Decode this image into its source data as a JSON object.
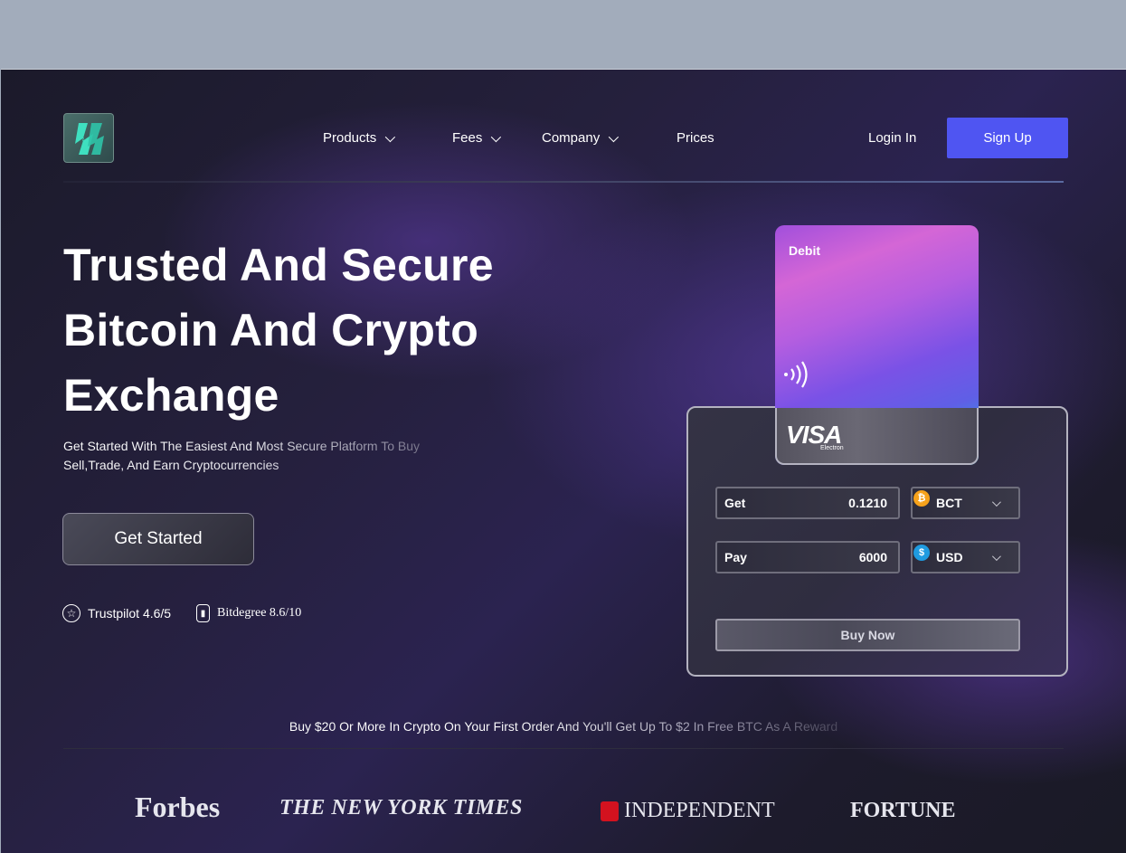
{
  "nav": {
    "logo_icon": "brand-logo-icon",
    "items": [
      {
        "label": "Products",
        "has_dropdown": true
      },
      {
        "label": "Fees",
        "has_dropdown": true
      },
      {
        "label": "Company",
        "has_dropdown": true
      },
      {
        "label": "Prices",
        "has_dropdown": false
      }
    ],
    "login": "Login In",
    "signup": "Sign Up"
  },
  "hero": {
    "title": "Trusted And Secure Bitcoin And Crypto Exchange",
    "subtitle": "Get Started  With The Easiest  And Most Secure Platform To Buy Sell,Trade, And Earn Cryptocurrencies",
    "cta": "Get Started",
    "ratings": [
      {
        "icon": "star-icon",
        "label": "Trustpilot 4.6/5"
      },
      {
        "icon": "badge-icon",
        "label": "Bitdegree 8.6/10"
      }
    ]
  },
  "card": {
    "type": "Debit",
    "contactless_icon": "contactless-icon",
    "brand": "VISA",
    "brand_sub": "Electron"
  },
  "exchange": {
    "get_label": "Get",
    "get_value": "0.1210",
    "get_currency": "BCT",
    "get_icon": "bitcoin-icon",
    "pay_label": "Pay",
    "pay_value": "6000",
    "pay_currency": "USD",
    "pay_icon": "dollar-icon",
    "buy_label": "Buy Now"
  },
  "promo": "Buy $20 Or More In Crypto On Your First  Order  And You'll Get Up To $2 In Free BTC As A Reward",
  "press": [
    "Forbes",
    "THE NEW YORK TIMES",
    "INDEPENDENT",
    "FORTUNE"
  ],
  "colors": {
    "accent": "#4f55f2",
    "bitcoin": "#f7a21b",
    "dollar": "#1f9be0"
  }
}
